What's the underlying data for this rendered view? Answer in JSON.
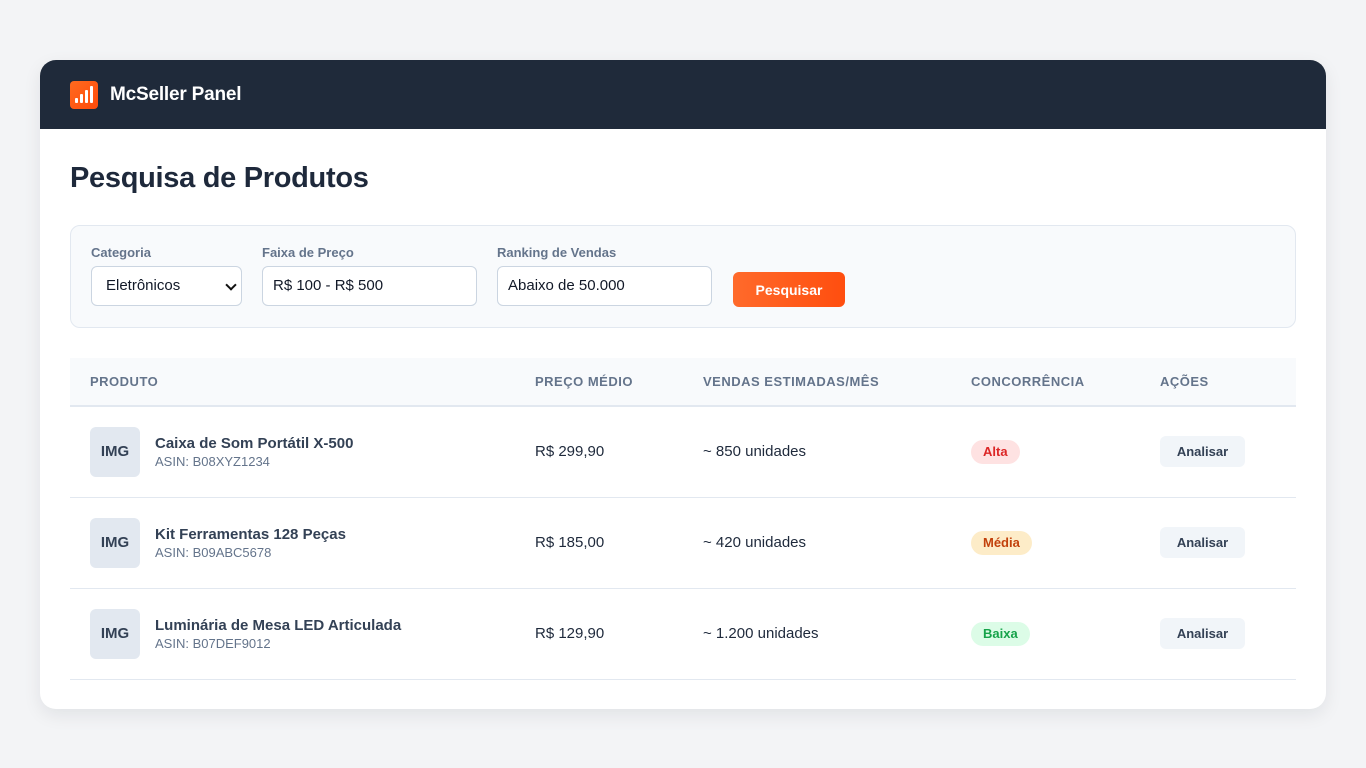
{
  "header": {
    "brand": "McSeller Panel",
    "logo_icon": "bar-chart-icon"
  },
  "page": {
    "title": "Pesquisa de Produtos"
  },
  "filters": {
    "category": {
      "label": "Categoria",
      "value": "Eletrônicos"
    },
    "price": {
      "label": "Faixa de Preço",
      "value": "R$ 100 - R$ 500"
    },
    "ranking": {
      "label": "Ranking de Vendas",
      "value": "Abaixo de 50.000"
    },
    "search_label": "Pesquisar"
  },
  "table": {
    "headers": [
      "PRODUTO",
      "PREÇO MÉDIO",
      "VENDAS ESTIMADAS/MÊS",
      "CONCORRÊNCIA",
      "AÇÕES"
    ],
    "rows": [
      {
        "thumb": "IMG",
        "name": "Caixa de Som Portátil X-500",
        "asin": "ASIN: B08XYZ1234",
        "price": "R$ 299,90",
        "sales": "~ 850 unidades",
        "competition": "Alta",
        "action": "Analisar"
      },
      {
        "thumb": "IMG",
        "name": "Kit Ferramentas 128 Peças",
        "asin": "ASIN: B09ABC5678",
        "price": "R$ 185,00",
        "sales": "~ 420 unidades",
        "competition": "Média",
        "action": "Analisar"
      },
      {
        "thumb": "IMG",
        "name": "Luminária de Mesa LED Articulada",
        "asin": "ASIN: B07DEF9012",
        "price": "R$ 129,90",
        "sales": "~ 1.200 unidades",
        "competition": "Baixa",
        "action": "Analisar"
      }
    ]
  },
  "colors": {
    "header_bg": "#1f2a3a",
    "accent": "#ff5a1a",
    "badge_high_bg": "#fee2e2",
    "badge_high_fg": "#dc2626",
    "badge_mid_bg": "#fdecc8",
    "badge_mid_fg": "#c2410c",
    "badge_low_bg": "#dcfce7",
    "badge_low_fg": "#16a34a"
  }
}
